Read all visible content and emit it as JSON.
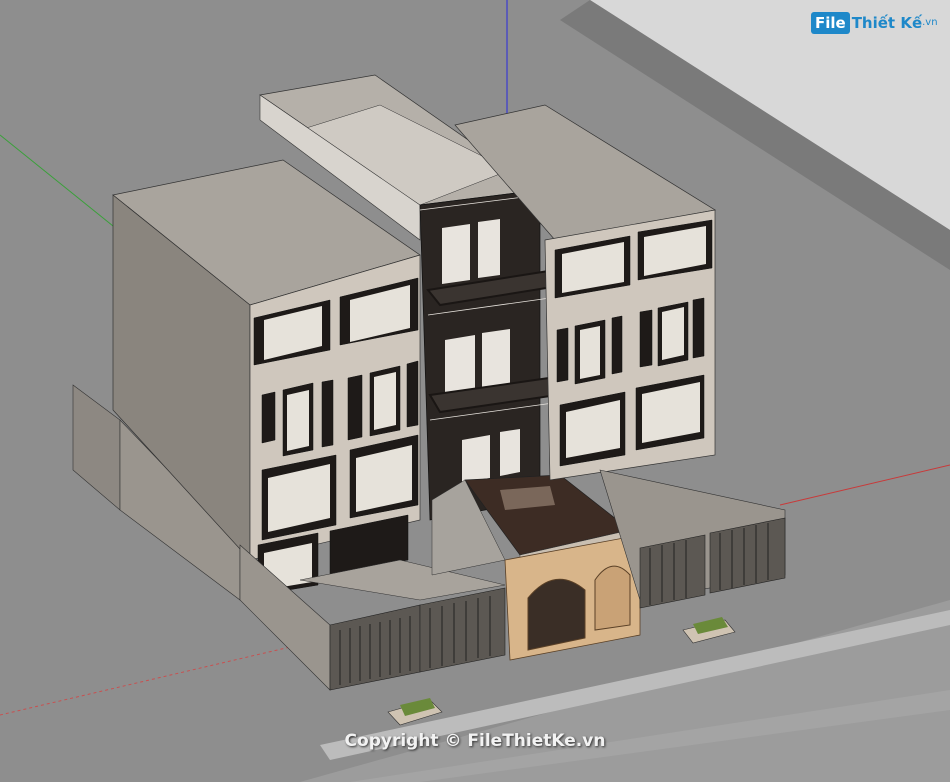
{
  "logo": {
    "file": "File",
    "thietke": "Thiết Kế",
    "vn": ".vn"
  },
  "copyright": "Copyright © FileThietKe.vn",
  "colors": {
    "ground": "#8c8c8c",
    "road": "#9a9a9a",
    "curb": "#c8c8c8",
    "wall": "#8a857e",
    "facade": "#cfc7bd",
    "dark": "#2a2522",
    "gate": "#d8b58a",
    "axis_blue": "#3a3ad0",
    "axis_red": "#c83a3a",
    "axis_green": "#3aa03a"
  }
}
